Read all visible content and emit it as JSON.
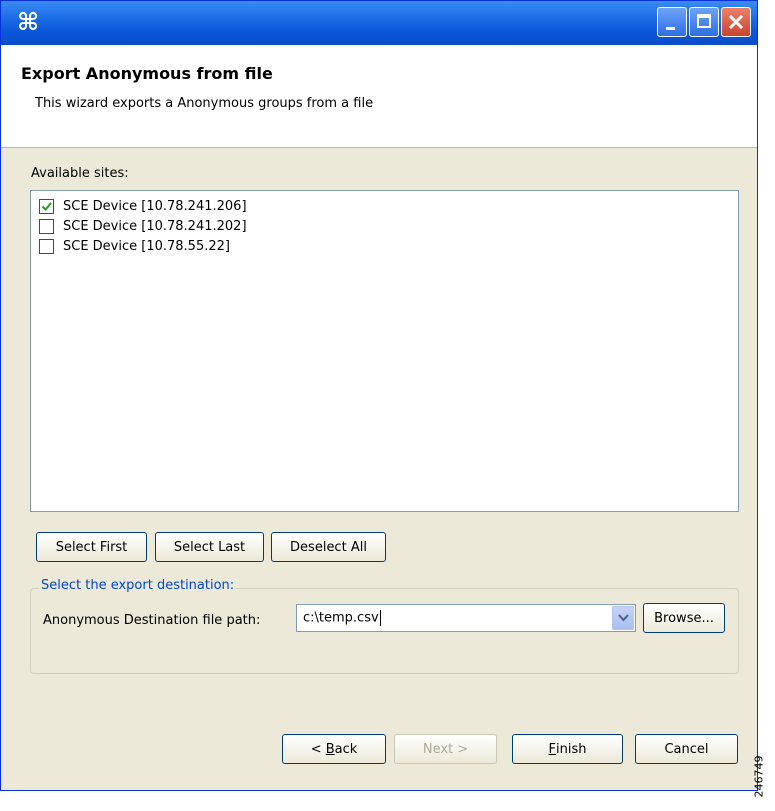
{
  "window": {
    "icon": "app-icon",
    "title_buttons": [
      "minimize-button",
      "maximize-button",
      "close-button"
    ]
  },
  "header": {
    "title": "Export Anonymous from file",
    "description": "This wizard exports a Anonymous groups from a file"
  },
  "sites": {
    "label": "Available sites:",
    "items": [
      {
        "label": "SCE Device [10.78.241.206]",
        "checked": true
      },
      {
        "label": "SCE Device [10.78.241.202]",
        "checked": false
      },
      {
        "label": "SCE Device [10.78.55.22]",
        "checked": false
      }
    ]
  },
  "selection_buttons": {
    "select_first": "Select First",
    "select_last": "Select Last",
    "deselect_all": "Deselect All"
  },
  "destination": {
    "legend": "Select the export destination:",
    "label": "Anonymous Destination file path:",
    "value": "c:\\temp.csv",
    "browse": "Browse..."
  },
  "footer": {
    "back_prefix": "< ",
    "back_key": "B",
    "back_rest": "ack",
    "next": "Next >",
    "next_enabled": false,
    "finish_key": "F",
    "finish_rest": "inish",
    "cancel": "Cancel"
  },
  "side_code": "246749",
  "colors": {
    "titlebar": "#0a57d7",
    "dialog_bg": "#ece9d8",
    "legend_text": "#0046d5",
    "checkmark": "#21a121"
  }
}
